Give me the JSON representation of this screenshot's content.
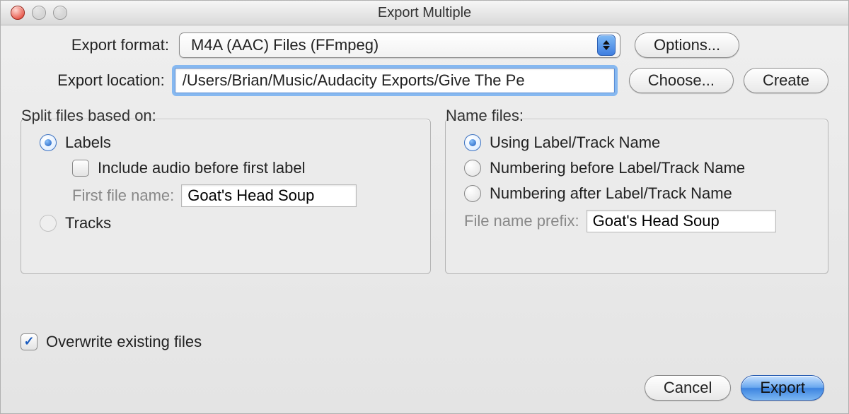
{
  "window": {
    "title": "Export Multiple"
  },
  "format": {
    "label": "Export format:",
    "value": "M4A (AAC) Files (FFmpeg)",
    "options_button": "Options..."
  },
  "location": {
    "label": "Export location:",
    "value": "/Users/Brian/Music/Audacity Exports/Give The Pe",
    "choose_button": "Choose...",
    "create_button": "Create"
  },
  "split": {
    "caption": "Split files based on:",
    "labels_option": "Labels",
    "include_before": "Include audio before first label",
    "first_file_label": "First file name:",
    "first_file_value": "Goat's Head Soup",
    "tracks_option": "Tracks",
    "selected": "labels",
    "include_checked": false
  },
  "name": {
    "caption": "Name files:",
    "using_option": "Using Label/Track Name",
    "num_before_option": "Numbering before Label/Track Name",
    "num_after_option": "Numbering after Label/Track Name",
    "prefix_label": "File name prefix:",
    "prefix_value": "Goat's Head Soup",
    "selected": "using"
  },
  "overwrite": {
    "label": "Overwrite existing files",
    "checked": true
  },
  "buttons": {
    "cancel": "Cancel",
    "export": "Export"
  }
}
